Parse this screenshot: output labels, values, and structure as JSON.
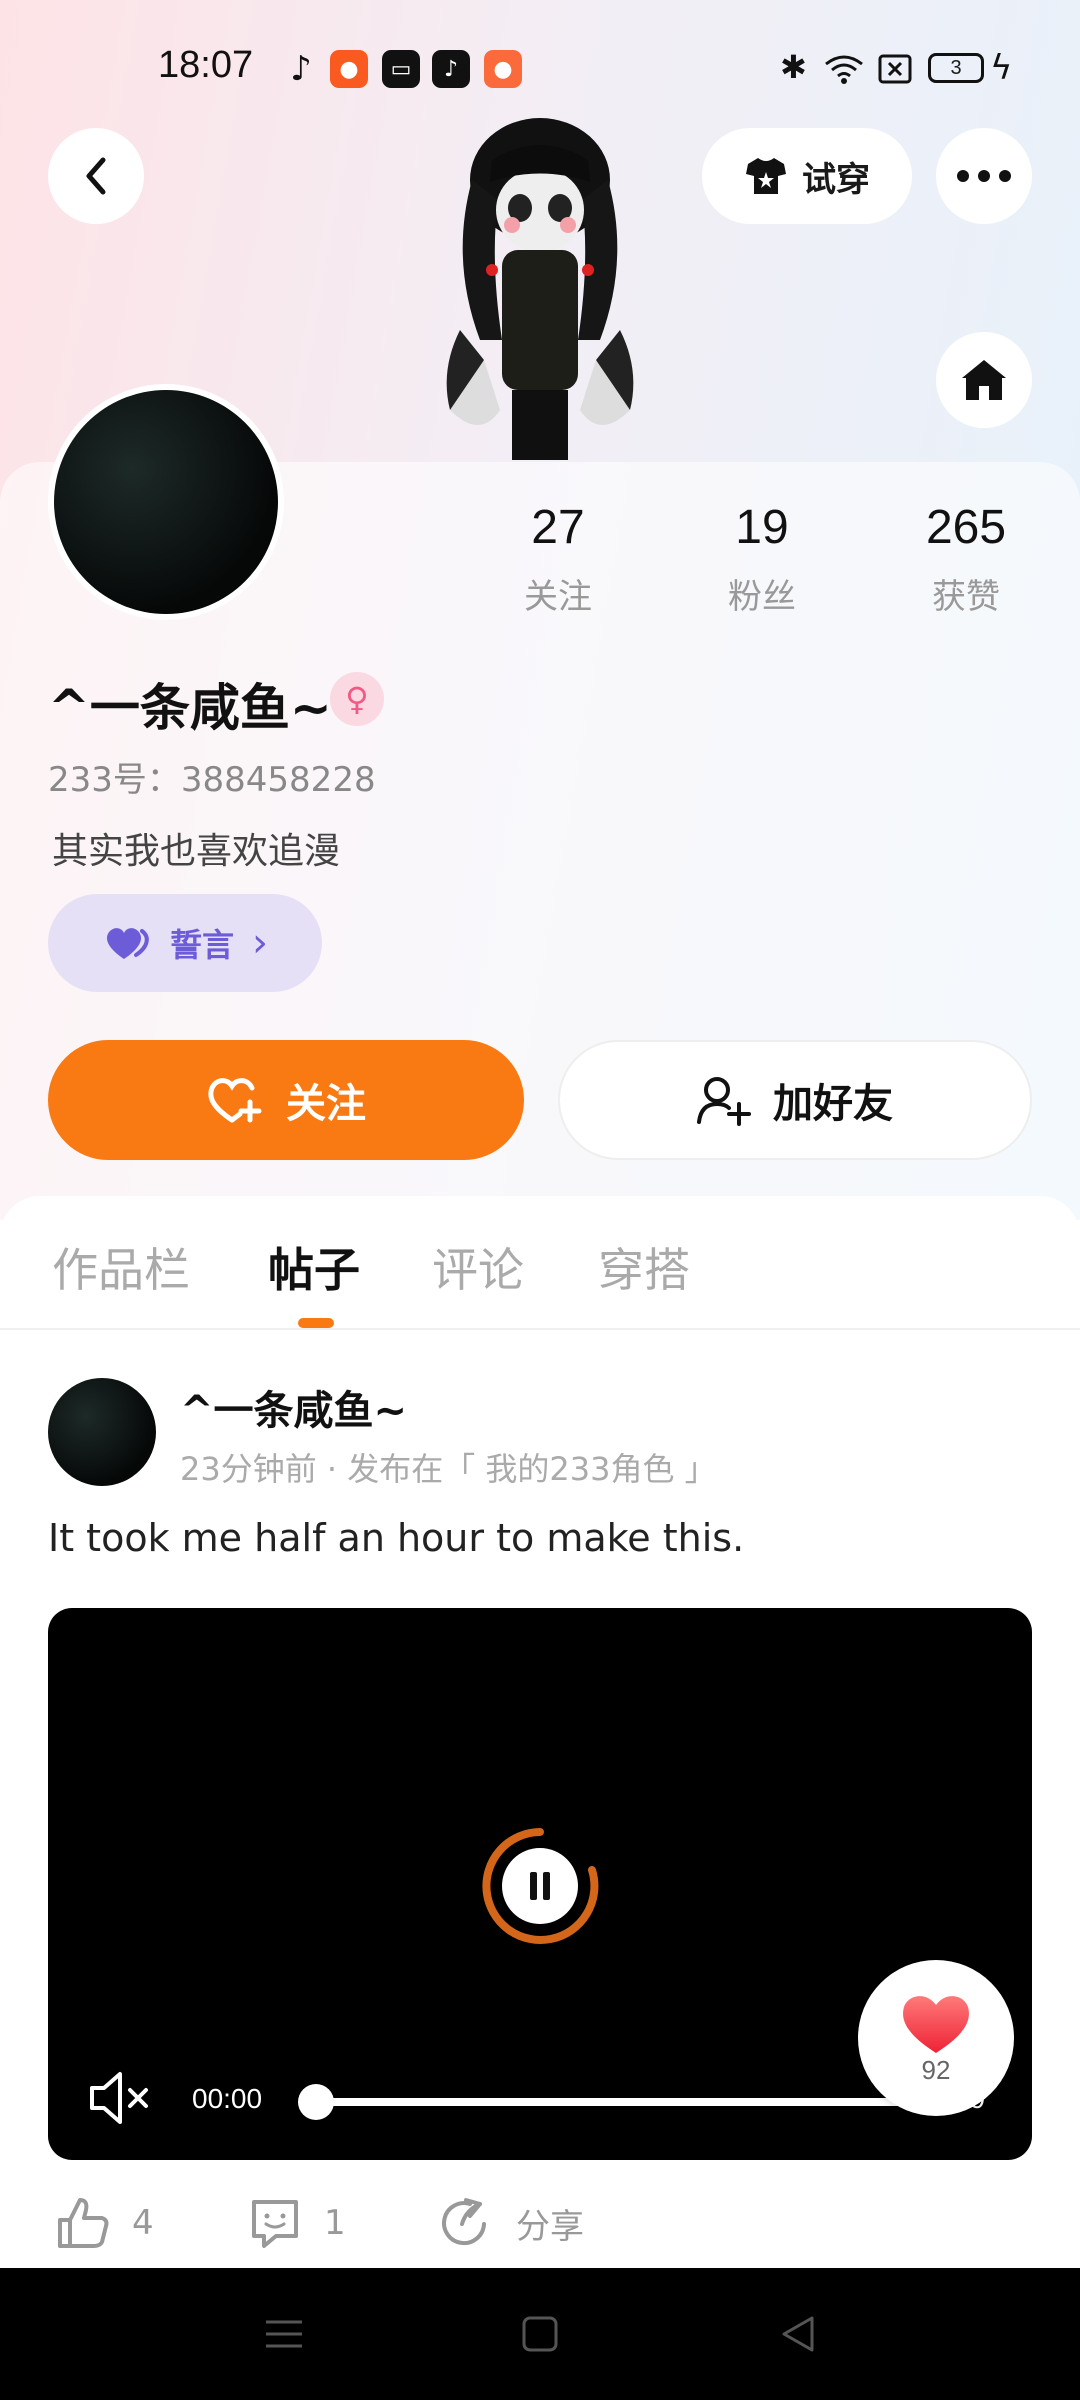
{
  "status_bar": {
    "time": "18:07",
    "battery": "3",
    "apps": [
      {
        "icon": "tiktok-music-icon",
        "color": "#111111"
      },
      {
        "icon": "kuaishou-icon",
        "color": "#fa5a1f"
      },
      {
        "icon": "camera-record-icon",
        "color": "#111111"
      },
      {
        "icon": "tiktok-icon",
        "color": "#111111"
      },
      {
        "icon": "kuaishou-lite-icon",
        "color": "#fa6a3a"
      }
    ]
  },
  "header": {
    "try_on_label": "试穿"
  },
  "profile": {
    "stats": [
      {
        "value": "27",
        "label": "关注"
      },
      {
        "value": "19",
        "label": "粉丝"
      },
      {
        "value": "265",
        "label": "获赞"
      }
    ],
    "name": "^一条咸鱼~",
    "gender_symbol": "♀",
    "id_text": "233号：388458228",
    "bio": "其实我也喜欢追漫",
    "vow_label": "誓言",
    "vow_chevron": "›",
    "follow_label": "关注",
    "add_friend_label": "加好友"
  },
  "tabs": [
    {
      "label": "作品栏",
      "active": false
    },
    {
      "label": "帖子",
      "active": true
    },
    {
      "label": "评论",
      "active": false
    },
    {
      "label": "穿搭",
      "active": false
    }
  ],
  "post": {
    "author": "^一条咸鱼~",
    "meta": "23分钟前 · 发布在「 我的233角色 」",
    "text": "It took me half an hour to make this.",
    "video": {
      "current_time": "00:00",
      "duration_visible": "09",
      "progress": 0,
      "muted": true,
      "state": "paused-loading"
    },
    "heart_count": "92",
    "likes": "4",
    "comments": "1",
    "share_label": "分享"
  },
  "colors": {
    "accent": "#f97a12",
    "vow": "#6d5cd8",
    "gender": "#f05a85"
  }
}
